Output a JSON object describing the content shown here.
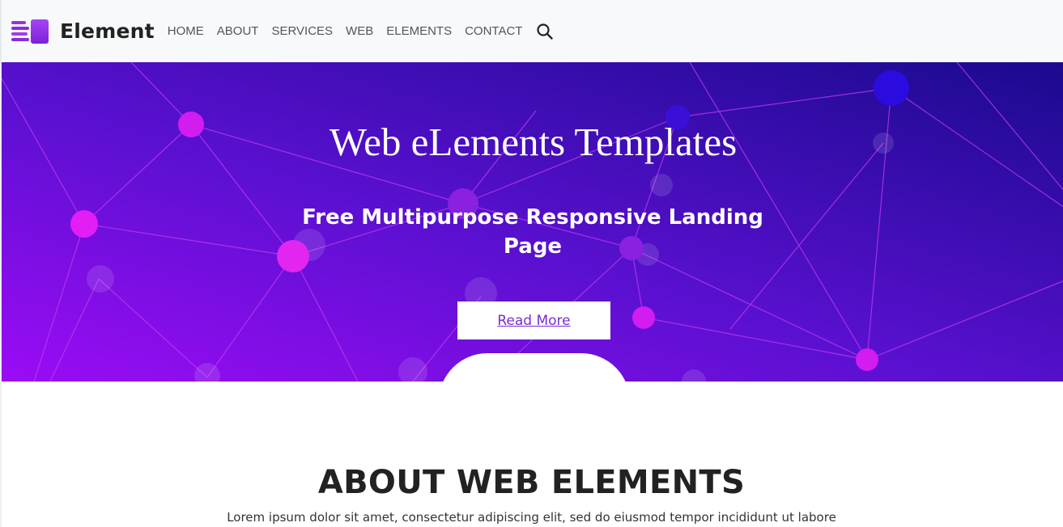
{
  "brand": {
    "name": "Element",
    "icon": "stacked-bars-logo-icon"
  },
  "nav": {
    "items": [
      "HOME",
      "ABOUT",
      "SERVICES",
      "WEB",
      "ELEMENTS",
      "CONTACT"
    ],
    "search_icon": "search-icon"
  },
  "hero": {
    "title": "Web eLements Templates",
    "subtitle": "Free Multipurpose Responsive Landing Page",
    "button_label": "Read More"
  },
  "about": {
    "title": "ABOUT WEB ELEMENTS",
    "text": "Lorem ipsum dolor sit amet, consectetur adipiscing elit, sed do eiusmod tempor incididunt ut labore"
  },
  "colors": {
    "accent": "#8a2be2",
    "hero_gradient_start": "#4a0ab8",
    "hero_gradient_end": "#2a0aa8",
    "node": "#d21cf0"
  }
}
